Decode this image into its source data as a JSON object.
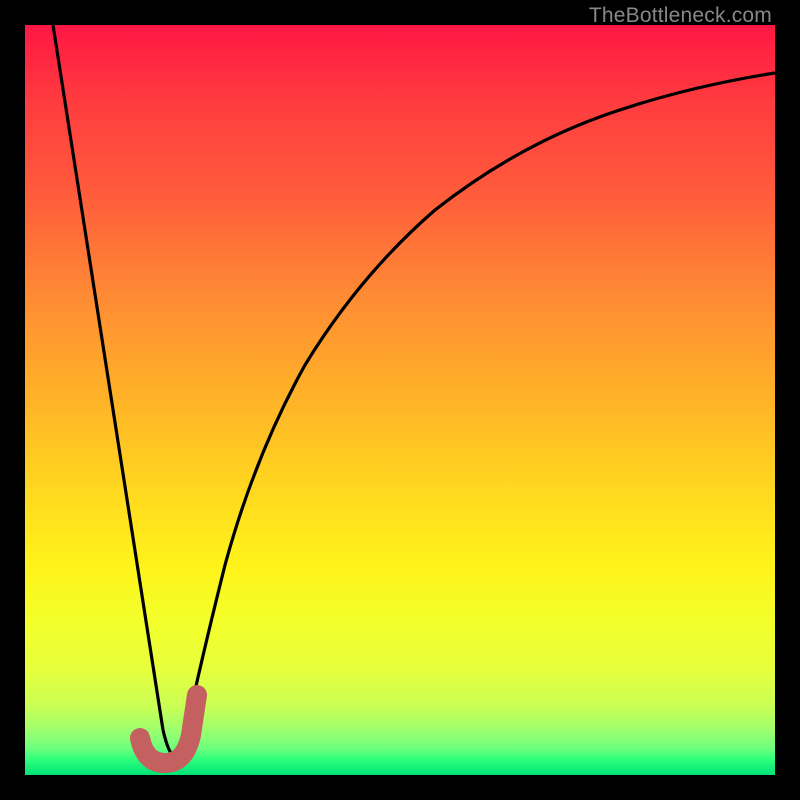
{
  "watermark": "TheBottleneck.com",
  "colors": {
    "curve": "#000000",
    "tick_mark": "#c56060",
    "frame": "#000000"
  },
  "chart_data": {
    "type": "line",
    "title": "",
    "xlabel": "",
    "ylabel": "",
    "xlim": [
      0,
      100
    ],
    "ylim": [
      0,
      100
    ],
    "x": [
      0,
      5,
      10,
      14,
      16,
      18,
      20,
      22,
      24,
      28,
      32,
      38,
      45,
      55,
      65,
      75,
      85,
      95,
      100
    ],
    "y": [
      100,
      73,
      46,
      25,
      14,
      5,
      0,
      5,
      15,
      33,
      47,
      60,
      71,
      80,
      86,
      90,
      92.5,
      94,
      94.7
    ],
    "note": "Values are read in percent of plot area; y is bottleneck-like metric that dips to 0 near x≈20 then rises asymptotically.",
    "annotations": [
      {
        "kind": "check-mark",
        "approx_x": 20,
        "approx_y": 3,
        "color": "#c56060"
      }
    ]
  }
}
